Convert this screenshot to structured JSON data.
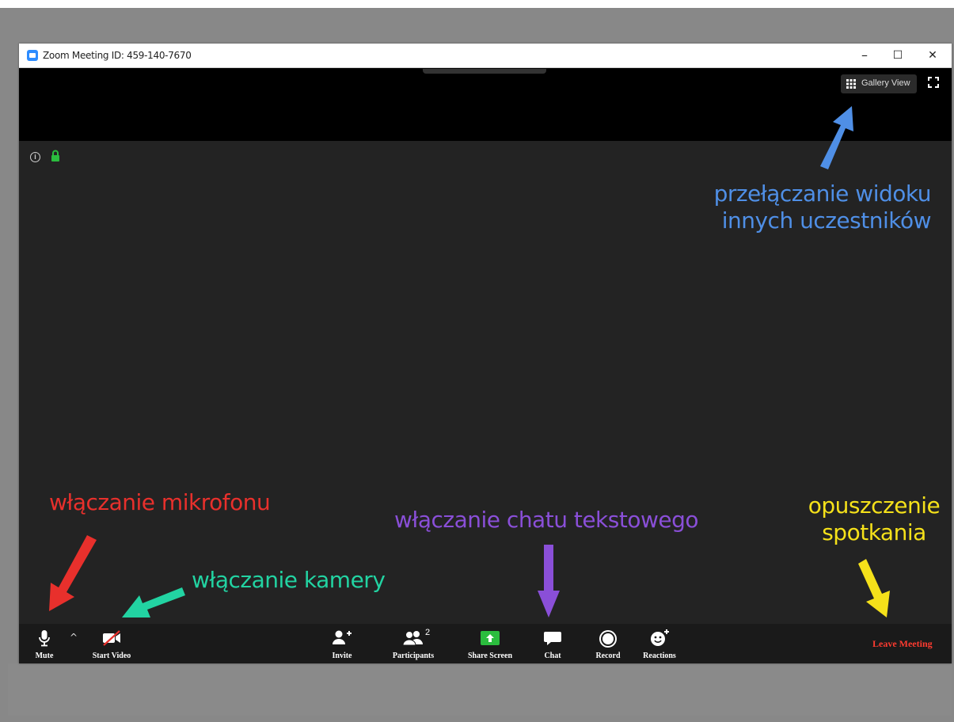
{
  "window": {
    "title": "Zoom Meeting ID: 459-140-7670",
    "controls": {
      "minimize": "–",
      "maximize": "☐",
      "close": "✕"
    }
  },
  "top_bar": {
    "gallery_view": "Gallery View"
  },
  "toolbar": {
    "mute": "Mute",
    "start_video": "Start Video",
    "invite": "Invite",
    "participants": "Participants",
    "participants_count": "2",
    "share_screen": "Share Screen",
    "chat": "Chat",
    "record": "Record",
    "reactions": "Reactions",
    "leave_meeting": "Leave Meeting"
  },
  "annotations": {
    "gallery_line1": "przełączanie widoku",
    "gallery_line2": "innych uczestników",
    "microphone": "włączanie mikrofonu",
    "camera": "włączanie kamery",
    "chat": "włączanie chatu tekstowego",
    "leave_line1": "opuszczenie",
    "leave_line2": "spotkania"
  },
  "colors": {
    "accent_blue": "#4f8fe6",
    "accent_red": "#e8302c",
    "accent_teal": "#22d3a2",
    "accent_purple": "#8a4fd8",
    "accent_yellow": "#f5e11a",
    "leave_red": "#ff3b30",
    "share_green": "#2bbd3e",
    "lock_green": "#2bbd3e"
  },
  "icons": {
    "microphone": "microphone-icon",
    "camera_off": "video-off-icon",
    "invite": "invite-user-icon",
    "participants": "participants-icon",
    "share": "share-screen-icon",
    "chat": "chat-bubble-icon",
    "record": "record-icon",
    "reactions": "reactions-icon",
    "gallery": "grid-icon",
    "fullscreen": "fullscreen-icon",
    "info": "info-icon",
    "lock": "lock-icon"
  }
}
